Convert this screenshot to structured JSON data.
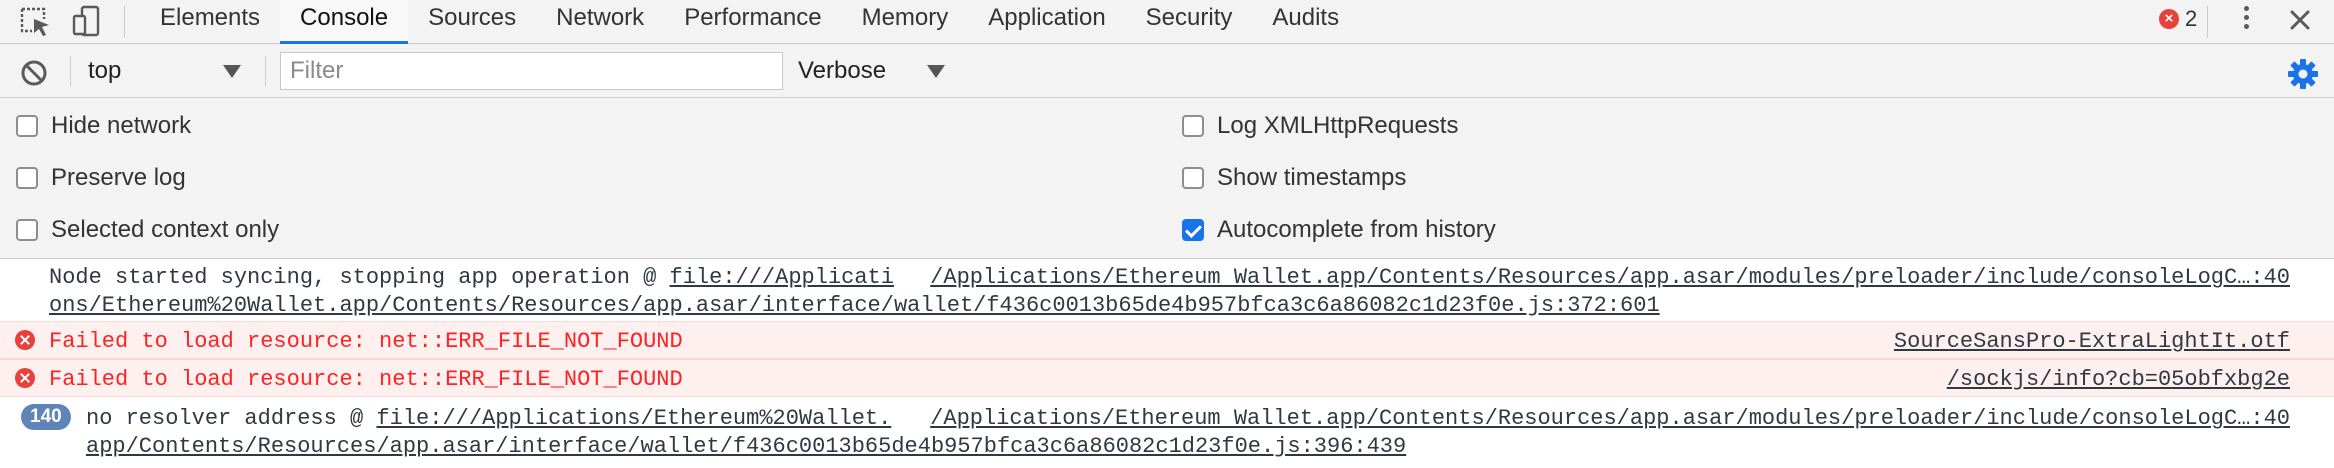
{
  "toolbar": {
    "tabs": [
      "Elements",
      "Console",
      "Sources",
      "Network",
      "Performance",
      "Memory",
      "Application",
      "Security",
      "Audits"
    ],
    "active_tab": "Console",
    "error_count": "2"
  },
  "filterbar": {
    "context_value": "top",
    "filter_placeholder": "Filter",
    "level_value": "Verbose"
  },
  "settings": {
    "hide_network": {
      "label": "Hide network",
      "checked": false
    },
    "preserve_log": {
      "label": "Preserve log",
      "checked": false
    },
    "selected_context_only": {
      "label": "Selected context only",
      "checked": false
    },
    "log_xhr": {
      "label": "Log XMLHttpRequests",
      "checked": false
    },
    "show_timestamps": {
      "label": "Show timestamps",
      "checked": false
    },
    "autocomplete_history": {
      "label": "Autocomplete from history",
      "checked": true
    }
  },
  "messages": [
    {
      "type": "info",
      "text": "Node started syncing, stopping app operation @ ",
      "link_line1": "file:///Applicati",
      "link_line2": "ons/Ethereum%20Wallet.app/Contents/Resources/app.asar/interface/wallet/f436c0013b65de4b957bfca3c6a86082c1d23f0e.js:372:601",
      "source": "/Applications/Ethereum Wallet.app/Contents/Resources/app.asar/modules/preloader/include/consoleLogC…:40"
    },
    {
      "type": "error",
      "text": "Failed to load resource: net::ERR_FILE_NOT_FOUND",
      "source": "SourceSansPro-ExtraLightIt.otf"
    },
    {
      "type": "error",
      "text": "Failed to load resource: net::ERR_FILE_NOT_FOUND",
      "source": "/sockjs/info?cb=05obfxbg2e"
    },
    {
      "type": "info",
      "repeat_count": "140",
      "text": "no resolver address @ ",
      "link_line1": "file:///Applications/Ethereum%20Wallet.",
      "link_line2": "app/Contents/Resources/app.asar/interface/wallet/f436c0013b65de4b957bfca3c6a86082c1d23f0e.js:396:439",
      "source": "/Applications/Ethereum Wallet.app/Contents/Resources/app.asar/modules/preloader/include/consoleLogC…:40"
    }
  ],
  "colors": {
    "accent": "#1a73e8",
    "error": "#fe2222",
    "error_bg": "#fff0f0",
    "repeat_badge": "#5f85b8"
  },
  "icons": [
    "inspect-element-icon",
    "device-toolbar-icon",
    "error-icon",
    "more-options-icon",
    "close-icon",
    "clear-console-icon",
    "dropdown-caret-icon",
    "settings-gear-icon"
  ]
}
